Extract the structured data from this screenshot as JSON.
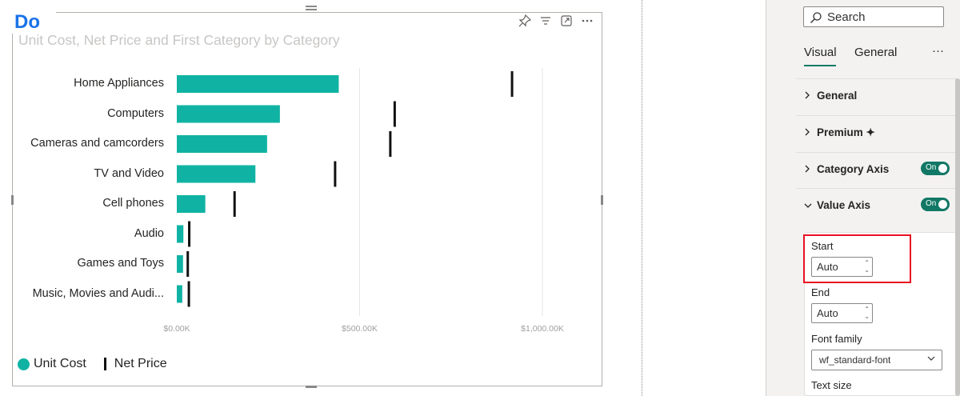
{
  "badge": {
    "text": "Do"
  },
  "visual": {
    "title": "Unit Cost, Net Price and First Category by Category"
  },
  "toolbar": {
    "icons": [
      "pin-icon",
      "filter-icon",
      "focus-mode-icon",
      "more-options-icon"
    ]
  },
  "chart_data": {
    "type": "bar",
    "orientation": "horizontal",
    "categories": [
      "Home Appliances",
      "Computers",
      "Cameras and camcorders",
      "TV and Video",
      "Cell phones",
      "Audio",
      "Games and Toys",
      "Music, Movies and Audi..."
    ],
    "series": [
      {
        "name": "Unit Cost",
        "mark": "bar",
        "color": "#10b3a3",
        "values": [
          443,
          282,
          247,
          215,
          78,
          18,
          17,
          15
        ]
      },
      {
        "name": "Net Price",
        "mark": "line-marker",
        "color": "#111111",
        "values": [
          917,
          596,
          584,
          433,
          158,
          34,
          30,
          33
        ]
      }
    ],
    "x_ticks": [
      "$0.00K",
      "$500.00K",
      "$1,000.00K"
    ],
    "x_tick_values": [
      0,
      500,
      1000
    ],
    "xlim": [
      0,
      1130
    ],
    "grid": true,
    "legend_position": "bottom-left"
  },
  "legend": {
    "items": [
      "Unit Cost",
      "Net Price"
    ]
  },
  "pane": {
    "search_placeholder": "Search",
    "tabs": [
      "Visual",
      "General"
    ],
    "more": "···",
    "sections": [
      {
        "label": "General",
        "expanded": false
      },
      {
        "label": "Premium ✦",
        "expanded": false
      },
      {
        "label": "Category Axis",
        "expanded": false,
        "toggle": "On"
      },
      {
        "label": "Value Axis",
        "expanded": true,
        "toggle": "On"
      }
    ],
    "value_axis": {
      "start_label": "Start",
      "start_value": "Auto",
      "end_label": "End",
      "end_value": "Auto",
      "font_family_label": "Font family",
      "font_family_value": "wf_standard-font",
      "text_size_label": "Text size"
    }
  },
  "colors": {
    "accent": "#117865",
    "bar": "#10b3a3",
    "highlight": "#e81123"
  }
}
